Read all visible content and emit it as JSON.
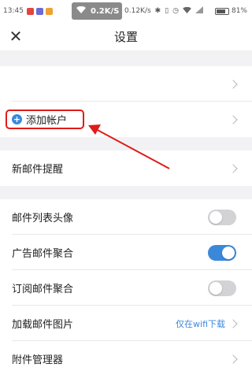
{
  "status_bar": {
    "time": "13:45",
    "speed": "0.2K/S",
    "speed_secondary": "0.12K/s",
    "battery": "81%",
    "battery_level": 0.81
  },
  "header": {
    "title": "设置",
    "close_symbol": "✕"
  },
  "rows": {
    "account_row": {
      "label": ""
    },
    "add_account": {
      "label": "添加帐户",
      "icon_symbol": "+"
    },
    "new_mail_alert": {
      "label": "新邮件提醒"
    },
    "list_avatar": {
      "label": "邮件列表头像",
      "enabled": false
    },
    "ad_aggregate": {
      "label": "广告邮件聚合",
      "enabled": true
    },
    "subscription_aggregate": {
      "label": "订阅邮件聚合",
      "enabled": false
    },
    "load_images": {
      "label": "加载邮件图片",
      "value": "仅在wifi下载"
    },
    "attachment_manager": {
      "label": "附件管理器"
    }
  },
  "colors": {
    "accent": "#3b88db",
    "annotation": "#e01b1b",
    "section_gap": "#f2f2f4"
  }
}
